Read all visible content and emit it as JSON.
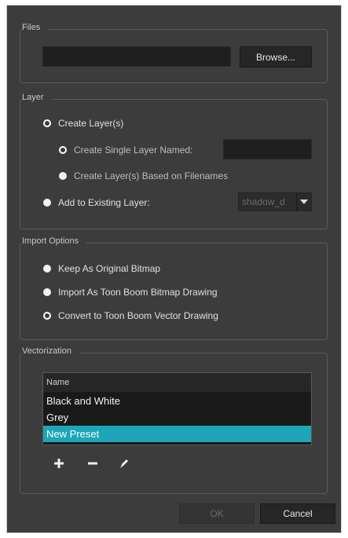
{
  "files": {
    "legend": "Files",
    "path_value": "",
    "browse_label": "Browse..."
  },
  "layer": {
    "legend": "Layer",
    "create_layers": "Create Layer(s)",
    "create_single": "Create Single Layer Named:",
    "single_name_value": "",
    "create_based": "Create Layer(s) Based on Filenames",
    "add_existing": "Add to Existing Layer:",
    "existing_value": "shadow_d"
  },
  "import_options": {
    "legend": "Import Options",
    "keep_original": "Keep As Original Bitmap",
    "import_toon": "Import As Toon Boom Bitmap Drawing",
    "convert_vector": "Convert to Toon Boom Vector Drawing"
  },
  "vectorization": {
    "legend": "Vectorization",
    "column_header": "Name",
    "presets": [
      "Black and White",
      "Grey",
      "New Preset"
    ],
    "selected_preset": "New Preset"
  },
  "footer": {
    "ok_label": "OK",
    "cancel_label": "Cancel"
  },
  "colors": {
    "selection": "#1da5b8",
    "panel_bg": "#3c3c3c"
  }
}
